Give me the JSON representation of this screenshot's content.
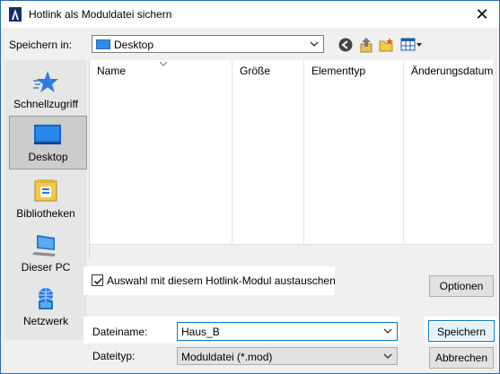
{
  "window": {
    "title": "Hotlink als Moduldatei sichern",
    "close_glyph": "✕"
  },
  "location": {
    "label": "Speichern in:",
    "value": "Desktop"
  },
  "toolbar_icons": [
    "back-icon",
    "up-folder-icon",
    "new-folder-icon",
    "view-menu-icon"
  ],
  "places": [
    {
      "label": "Schnellzugriff",
      "icon": "star-icon",
      "selected": false
    },
    {
      "label": "Desktop",
      "icon": "desktop-icon",
      "selected": true
    },
    {
      "label": "Bibliotheken",
      "icon": "libraries-icon",
      "selected": false
    },
    {
      "label": "Dieser PC",
      "icon": "computer-icon",
      "selected": false
    },
    {
      "label": "Netzwerk",
      "icon": "network-icon",
      "selected": false
    }
  ],
  "columns": [
    "Name",
    "Größe",
    "Elementtyp",
    "Änderungsdatum"
  ],
  "options": {
    "replace_checkbox": {
      "label": "Auswahl mit diesem Hotlink-Modul austauschen",
      "checked": true
    },
    "options_button": "Optionen"
  },
  "filename": {
    "label": "Dateiname:",
    "value": "Haus_B"
  },
  "filetype": {
    "label": "Dateityp:",
    "value": "Moduldatei (*.mod)"
  },
  "buttons": {
    "save": "Speichern",
    "cancel": "Abbrechen"
  }
}
